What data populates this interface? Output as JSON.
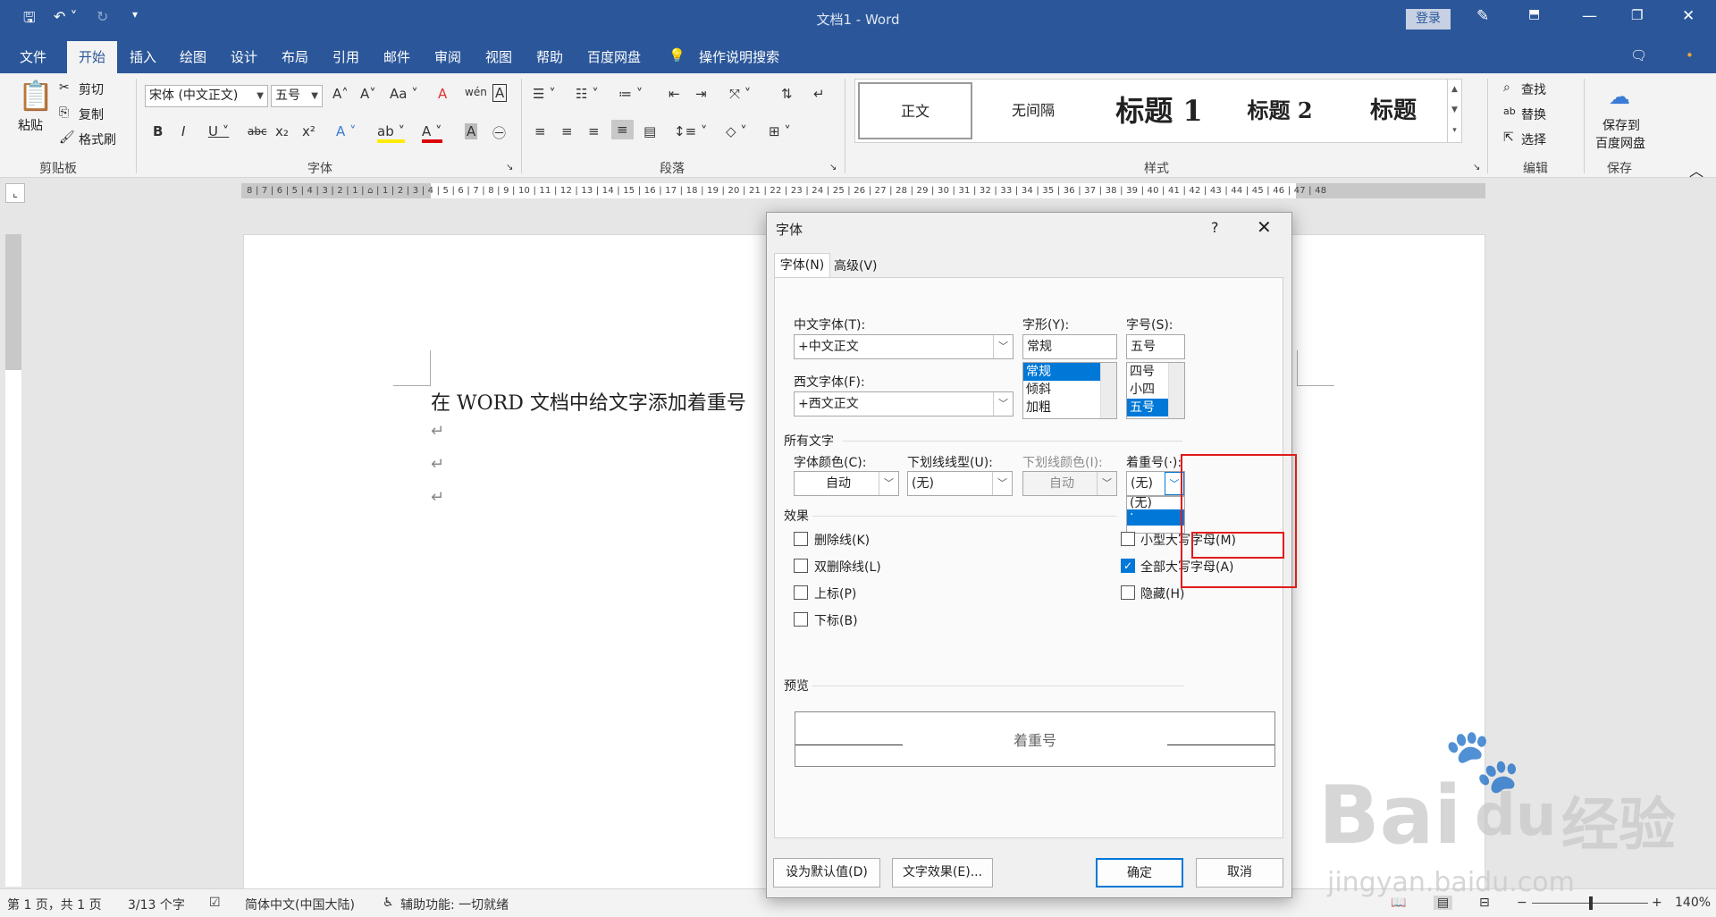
{
  "window": {
    "title": "文档1 - Word",
    "login": "登录"
  },
  "menu": [
    "文件",
    "开始",
    "插入",
    "绘图",
    "设计",
    "布局",
    "引用",
    "邮件",
    "审阅",
    "视图",
    "帮助",
    "百度网盘"
  ],
  "tell_me": "操作说明搜索",
  "ribbon": {
    "clipboard": {
      "paste": "粘贴",
      "cut": "剪切",
      "copy": "复制",
      "format_painter": "格式刷",
      "label": "剪贴板"
    },
    "font": {
      "font_name": "宋体 (中文正文)",
      "font_size": "五号",
      "label": "字体"
    },
    "paragraph": {
      "label": "段落"
    },
    "styles": {
      "items": [
        "正文",
        "无间隔",
        "标题 1",
        "标题 2",
        "标题"
      ],
      "label": "样式"
    },
    "editing": {
      "find": "查找",
      "replace": "替换",
      "select": "选择",
      "label": "编辑"
    },
    "save": {
      "save_to": "保存到",
      "baidu": "百度网盘",
      "label": "保存"
    }
  },
  "document": {
    "text": "在 WORD 文档中给文字添加着重号",
    "para_mark": "↵"
  },
  "status": {
    "page": "第 1 页，共 1 页",
    "words": "3/13 个字",
    "lang": "简体中文(中国大陆)",
    "access": "辅助功能: 一切就绪",
    "zoom": "140%"
  },
  "dialog": {
    "title": "字体",
    "help": "?",
    "close": "✕",
    "tabs": {
      "font": "字体(N)",
      "advanced": "高级(V)"
    },
    "cn_font_label": "中文字体(T):",
    "cn_font_value": "+中文正文",
    "west_font_label": "西文字体(F):",
    "west_font_value": "+西文正文",
    "style_label": "字形(Y):",
    "style_value": "常规",
    "style_options": [
      "常规",
      "倾斜",
      "加粗"
    ],
    "size_label": "字号(S):",
    "size_value": "五号",
    "size_options": [
      "四号",
      "小四",
      "五号"
    ],
    "all_text_label": "所有文字",
    "color_label": "字体颜色(C):",
    "color_value": "自动",
    "underline_label": "下划线线型(U):",
    "underline_value": "(无)",
    "underline_color_label": "下划线颜色(I):",
    "underline_color_value": "自动",
    "emphasis_label": "着重号(·):",
    "emphasis_value": "(无)",
    "emphasis_options": [
      "(无)",
      "·"
    ],
    "effects_label": "效果",
    "effects_left": [
      {
        "label": "删除线(K)",
        "checked": false
      },
      {
        "label": "双删除线(L)",
        "checked": false
      },
      {
        "label": "上标(P)",
        "checked": false
      },
      {
        "label": "下标(B)",
        "checked": false
      }
    ],
    "effects_right": [
      {
        "label": "小型大写字母(M)",
        "checked": false
      },
      {
        "label": "全部大写字母(A)",
        "checked": true
      },
      {
        "label": "隐藏(H)",
        "checked": false
      }
    ],
    "preview_label": "预览",
    "preview_text": "着重号",
    "buttons": {
      "default": "设为默认值(D)",
      "text_effects": "文字效果(E)...",
      "ok": "确定",
      "cancel": "取消"
    }
  },
  "watermark": {
    "brand": "Bai",
    "brand2": "du",
    "cn": "经验",
    "url": "jingyan.baidu.com"
  },
  "colors": {
    "accent": "#2b579a",
    "selection": "#0078d7",
    "highlight": "#e01b1b"
  }
}
